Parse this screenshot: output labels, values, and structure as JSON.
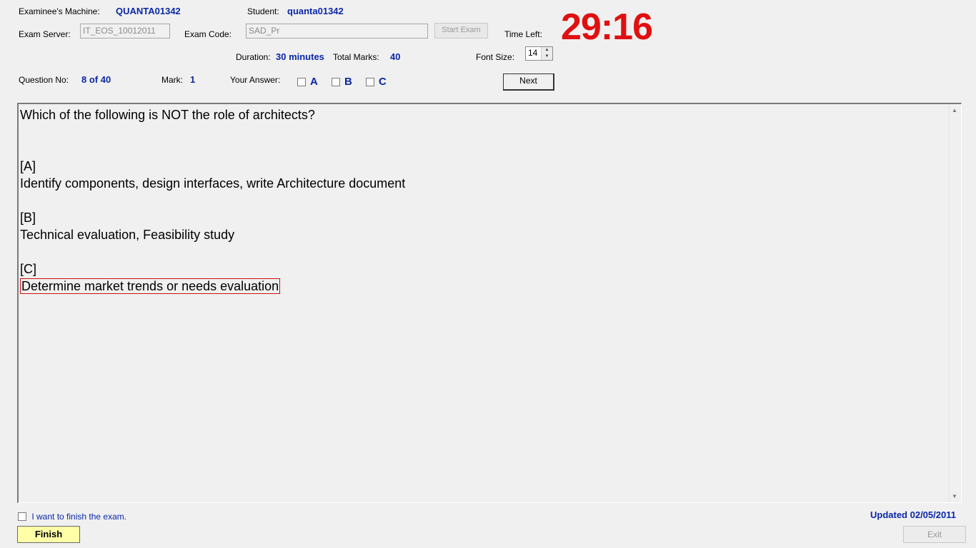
{
  "header": {
    "machine_label": "Examinee's Machine:",
    "machine_value": "QUANTA01342",
    "student_label": "Student:",
    "student_value": "quanta01342",
    "server_label": "Exam Server:",
    "server_value": "IT_EOS_10012011",
    "code_label": "Exam Code:",
    "code_value": "SAD_Pr",
    "start_exam_label": "Start Exam",
    "time_left_label": "Time Left:",
    "time_left_value": "29:16",
    "duration_label": "Duration:",
    "duration_value": "30 minutes",
    "total_marks_label": "Total Marks:",
    "total_marks_value": "40",
    "font_size_label": "Font Size:",
    "font_size_value": "14"
  },
  "question_bar": {
    "question_no_label": "Question No:",
    "question_no_value": "8 of 40",
    "mark_label": "Mark:",
    "mark_value": "1",
    "your_answer_label": "Your Answer:",
    "options": [
      "A",
      "B",
      "C"
    ],
    "next_label": "Next"
  },
  "question": {
    "text": "Which of the following is NOT the role of architects?",
    "answers": [
      {
        "key": "[A]",
        "text": "Identify components, design interfaces, write Architecture document"
      },
      {
        "key": "[B]",
        "text": "Technical evaluation, Feasibility study"
      },
      {
        "key": "[C]",
        "text": "Determine market trends or needs evaluation"
      }
    ]
  },
  "footer": {
    "finish_checkbox_label": "I want to finish the exam.",
    "finish_label": "Finish",
    "updated_text": "Updated 02/05/2011",
    "exit_label": "Exit"
  },
  "colors": {
    "timer": "#e01010",
    "value_blue": "#0a27a8",
    "finish_bg": "#ffffa8",
    "highlight_border": "#d01010"
  }
}
